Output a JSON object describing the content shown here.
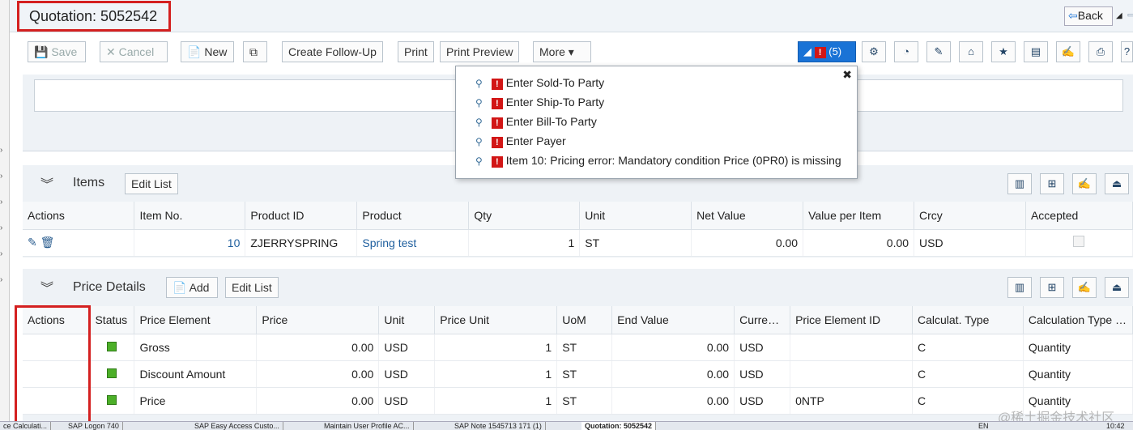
{
  "header": {
    "title": "Quotation: 5052542",
    "back_label": "Back",
    "back_icon": "back-arrow-icon"
  },
  "toolbar": {
    "save": "Save",
    "cancel": "Cancel",
    "new": "New",
    "create_follow_up": "Create Follow-Up",
    "print": "Print",
    "print_preview": "Print Preview",
    "more": "More",
    "messages_count": "(5)"
  },
  "messages": [
    "Enter Sold-To Party",
    "Enter Ship-To Party",
    "Enter Bill-To Party",
    "Enter Payer",
    "Item 10: Pricing error: Mandatory condition Price (0PR0) is missing"
  ],
  "items": {
    "title": "Items",
    "edit_list": "Edit List",
    "columns": [
      "Actions",
      "Item No.",
      "Product ID",
      "Product",
      "Qty",
      "Unit",
      "Net Value",
      "Value per Item",
      "Crcy",
      "Accepted"
    ],
    "rows": [
      {
        "item_no": "10",
        "product_id": "ZJERRYSPRING",
        "product": "Spring test",
        "qty": "1",
        "unit": "ST",
        "net_value": "0.00",
        "value_per_item": "0.00",
        "crcy": "USD"
      }
    ]
  },
  "price_details": {
    "title": "Price Details",
    "add": "Add",
    "edit_list": "Edit List",
    "columns": [
      "Actions",
      "Status",
      "Price Element",
      "Price",
      "Unit",
      "Price Unit",
      "UoM",
      "End Value",
      "Curre…",
      "Price Element ID",
      "Calculat. Type",
      "Calculation Type …"
    ],
    "rows": [
      {
        "element": "Gross",
        "price": "0.00",
        "unit": "USD",
        "price_unit": "1",
        "uom": "ST",
        "end_value": "0.00",
        "currency": "USD",
        "element_id": "",
        "calc_type": "C",
        "calc_type_desc": "Quantity"
      },
      {
        "element": "Discount Amount",
        "price": "0.00",
        "unit": "USD",
        "price_unit": "1",
        "uom": "ST",
        "end_value": "0.00",
        "currency": "USD",
        "element_id": "",
        "calc_type": "C",
        "calc_type_desc": "Quantity"
      },
      {
        "element": "Price",
        "price": "0.00",
        "unit": "USD",
        "price_unit": "1",
        "uom": "ST",
        "end_value": "0.00",
        "currency": "USD",
        "element_id": "0NTP",
        "calc_type": "C",
        "calc_type_desc": "Quantity"
      }
    ]
  },
  "taskbar": {
    "items": [
      "ce Calculati...",
      "SAP Logon 740",
      "SAP Easy Access  Custo...",
      "Maintain User Profile AC...",
      "SAP Note 1545713 171 (1)",
      "Quotation: 5052542"
    ],
    "lang": "EN",
    "clock": "10:42"
  },
  "watermark": "@稀土掘金技术社区",
  "colors": {
    "accent": "#1a73d6",
    "error": "#d21616",
    "status_ok": "#4caf28",
    "highlight_box": "#d42020"
  }
}
